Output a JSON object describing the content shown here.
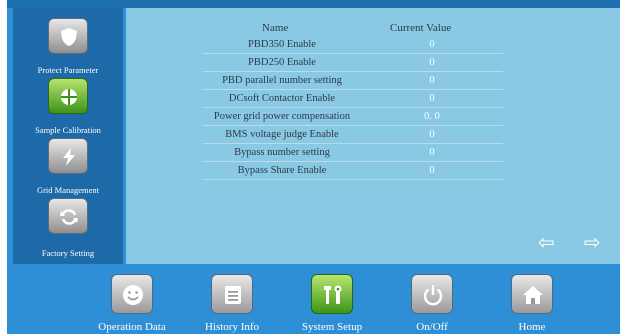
{
  "sidebar": {
    "items": [
      {
        "label": "Protect Parameter",
        "icon": "shield-icon",
        "active": false
      },
      {
        "label": "Sample Calibration",
        "icon": "target-icon",
        "active": true
      },
      {
        "label": "Grid Management",
        "icon": "lightning-icon",
        "active": false
      },
      {
        "label": "Factory Setting",
        "icon": "refresh-icon",
        "active": false
      }
    ]
  },
  "table": {
    "header_name": "Name",
    "header_value": "Current Value",
    "rows": [
      {
        "name": "PBD350 Enable",
        "value": "0"
      },
      {
        "name": "PBD250 Enable",
        "value": "0"
      },
      {
        "name": "PBD parallel number setting",
        "value": "0"
      },
      {
        "name": "DCsoft Contactor Enable",
        "value": "0"
      },
      {
        "name": "Power grid power compensation",
        "value": "0. 0"
      },
      {
        "name": "BMS voltage judge Enable",
        "value": "0"
      },
      {
        "name": "Bypass number setting",
        "value": "0"
      },
      {
        "name": "Bypass Share Enable",
        "value": "0"
      }
    ]
  },
  "pager": {
    "prev_icon": "arrow-left-icon",
    "next_icon": "arrow-right-icon",
    "prev_glyph": "⇦",
    "next_glyph": "⇨"
  },
  "bottom_nav": {
    "items": [
      {
        "label": "Operation Data",
        "icon": "smiley-icon",
        "active": false
      },
      {
        "label": "History Info",
        "icon": "document-icon",
        "active": false
      },
      {
        "label": "System Setup",
        "icon": "tools-icon",
        "active": true
      },
      {
        "label": "On/Off",
        "icon": "power-icon",
        "active": false
      },
      {
        "label": "Home",
        "icon": "home-icon",
        "active": false
      }
    ]
  },
  "colors": {
    "frame": "#2f8fd6",
    "sidebar": "#1e6aa8",
    "panel": "#8ac9e3",
    "active": "#5cb82a"
  }
}
